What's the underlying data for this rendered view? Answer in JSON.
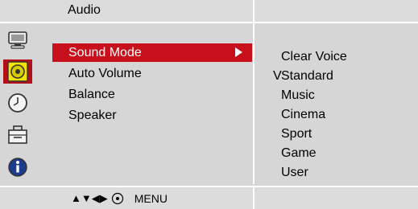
{
  "header": {
    "title": "Audio"
  },
  "sidebar": {
    "icons": [
      {
        "name": "monitor-icon"
      },
      {
        "name": "audio-icon",
        "active": true
      },
      {
        "name": "clock-icon"
      },
      {
        "name": "toolbox-icon"
      },
      {
        "name": "info-icon"
      }
    ]
  },
  "menu": {
    "items": [
      {
        "label": "Sound Mode",
        "selected": true
      },
      {
        "label": "Auto Volume"
      },
      {
        "label": "Balance"
      },
      {
        "label": "Speaker"
      }
    ]
  },
  "submenu": {
    "checkmark": "V",
    "checked_index": 1,
    "options": [
      "Clear Voice",
      "Standard",
      "Music",
      "Cinema",
      "Sport",
      "Game",
      "User"
    ]
  },
  "footer": {
    "nav_symbols": "▲▼◀▶",
    "menu_label": "MENU"
  },
  "colors": {
    "highlight": "#c8101c",
    "panel": "#d6d6d6",
    "divider": "#ffffff"
  }
}
